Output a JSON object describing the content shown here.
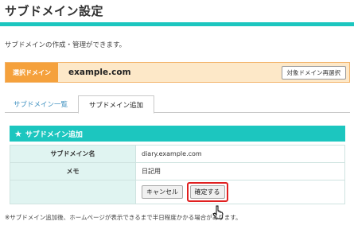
{
  "page": {
    "title": "サブドメイン設定",
    "description": "サブドメインの作成・管理ができます。"
  },
  "selected_domain": {
    "label": "選択ドメイン",
    "value": "example.com",
    "reselect_label": "対象ドメイン再選択"
  },
  "tabs": [
    {
      "label": "サブドメイン一覧",
      "active": false
    },
    {
      "label": "サブドメイン追加",
      "active": true
    }
  ],
  "section": {
    "title": "サブドメイン追加",
    "icon": "star-icon"
  },
  "form": {
    "rows": [
      {
        "label": "サブドメイン名",
        "value": "diary.example.com"
      },
      {
        "label": "メモ",
        "value": "日記用"
      }
    ],
    "cancel_label": "キャンセル",
    "confirm_label": "確定する"
  },
  "footnote": "※サブドメイン追加後、ホームページが表示できるまで半日程度かかる場合があります。",
  "colors": {
    "accent": "#1cc6bf",
    "domain_label_bg": "#f5a13c",
    "highlight": "#e02020"
  }
}
